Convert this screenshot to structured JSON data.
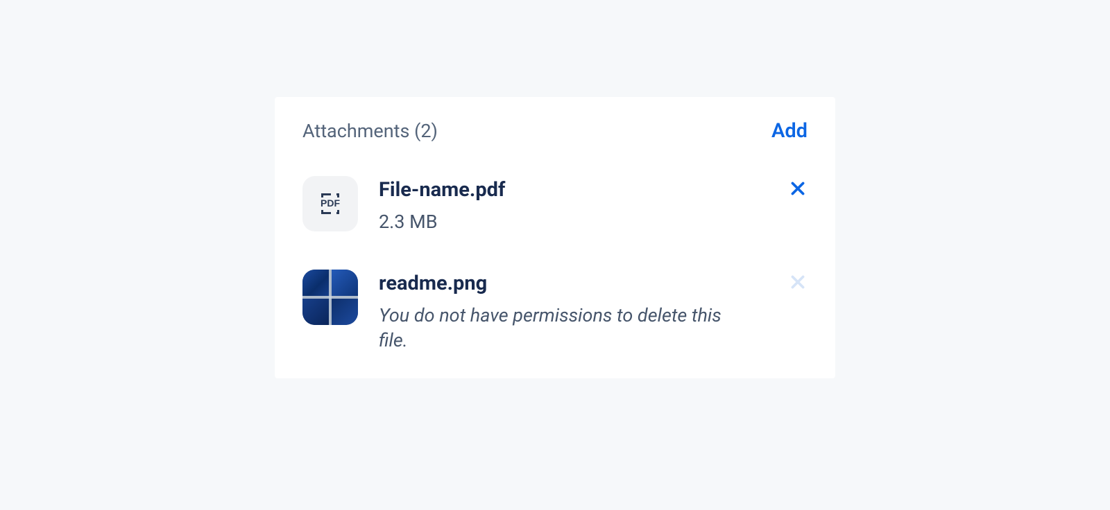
{
  "header": {
    "label": "Attachments (2)",
    "add_label": "Add"
  },
  "items": [
    {
      "icon": "pdf",
      "name": "File-name.pdf",
      "meta": "2.3 MB",
      "meta_italic": false,
      "removable": true
    },
    {
      "icon": "image",
      "name": "readme.png",
      "meta": "You do not have permissions to delete this file.",
      "meta_italic": true,
      "removable": false
    }
  ],
  "colors": {
    "accent": "#0c66e4",
    "text_primary": "#182a4e",
    "text_secondary": "#54647a"
  }
}
